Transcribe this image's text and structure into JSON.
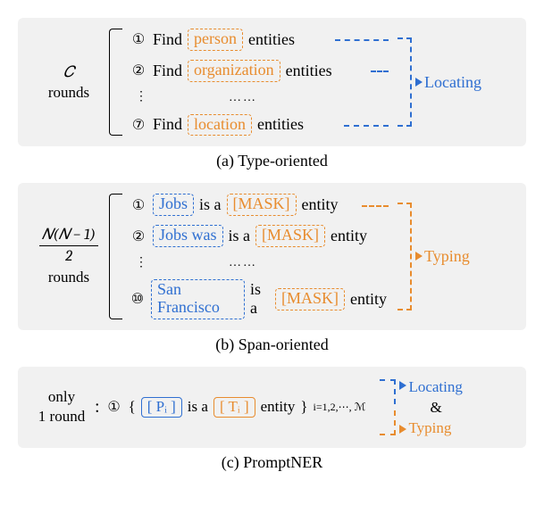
{
  "panelA": {
    "rounds_label_top": "𝐶",
    "rounds_label_bottom": "rounds",
    "rows": [
      {
        "num": "①",
        "prefix": "Find",
        "chip": "person",
        "suffix": "entities"
      },
      {
        "num": "②",
        "prefix": "Find",
        "chip": "organization",
        "suffix": "entities"
      },
      {
        "num": "⑦",
        "prefix": "Find",
        "chip": "location",
        "suffix": "entities"
      }
    ],
    "ellipsis": "……",
    "vdots": "⋮",
    "output": "Locating"
  },
  "captionA": "(a) Type-oriented",
  "panelB": {
    "rounds_frac_num": "𝑁(𝑁 − 1)",
    "rounds_frac_den": "2",
    "rounds_label_bottom": "rounds",
    "rows": [
      {
        "num": "①",
        "chip": "Jobs",
        "mid": "is a",
        "mask": "[MASK]",
        "suffix": "entity"
      },
      {
        "num": "②",
        "chip": "Jobs was",
        "mid": "is a",
        "mask": "[MASK]",
        "suffix": "entity"
      },
      {
        "num": "⑩",
        "chip": "San Francisco",
        "mid": "is a",
        "mask": "[MASK]",
        "suffix": "entity"
      }
    ],
    "ellipsis": "……",
    "vdots": "⋮",
    "output": "Typing"
  },
  "captionB": "(b) Span-oriented",
  "panelC": {
    "left_top": "only",
    "left_bottom": "1 round",
    "colon": ":",
    "num": "①",
    "lbrace": "{",
    "p_token": "[ Pᵢ ]",
    "mid": "is a",
    "t_token": "[ Tᵢ ]",
    "suffix": "entity",
    "rbrace": "}",
    "index_expr": "i=1,2,⋯, ℳ",
    "out_top": "Locating",
    "out_amp": "&",
    "out_bot": "Typing"
  },
  "captionC": "(c) PromptNER"
}
